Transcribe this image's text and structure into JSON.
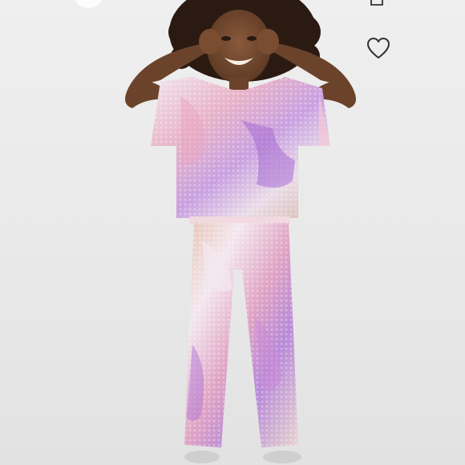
{
  "listing": {
    "image": {
      "subject": "child-model-sequin-outfit",
      "background_color": "#ececec"
    },
    "actions": {
      "like": {
        "icon": "heart-outline-icon"
      },
      "share": {
        "icon": "share-icon"
      },
      "other": {
        "icon": "circle-button-icon"
      }
    },
    "colors": {
      "sequin_pink": "#e9a6c0",
      "sequin_purple": "#a86cd2",
      "sequin_silver": "#e6e4ea",
      "sequin_gold": "#d8b9a0",
      "icon_stroke": "#333333"
    }
  }
}
